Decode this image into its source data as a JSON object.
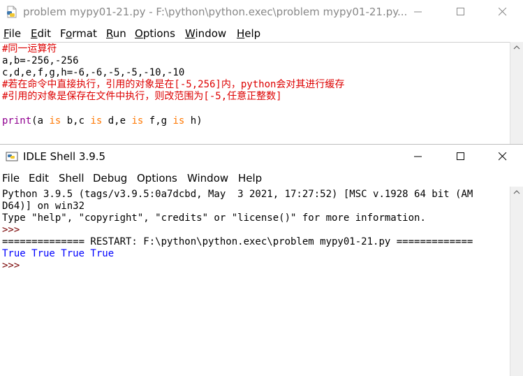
{
  "editor": {
    "title": "problem mypy01-21.py - F:\\python\\python.exec\\problem mypy01-21.py...",
    "menu": [
      {
        "pre": "",
        "u": "F",
        "post": "ile"
      },
      {
        "pre": "",
        "u": "E",
        "post": "dit"
      },
      {
        "pre": "F",
        "u": "o",
        "post": "rmat"
      },
      {
        "pre": "",
        "u": "R",
        "post": "un"
      },
      {
        "pre": "",
        "u": "O",
        "post": "ptions"
      },
      {
        "pre": "",
        "u": "W",
        "post": "indow"
      },
      {
        "pre": "",
        "u": "H",
        "post": "elp"
      }
    ],
    "lines": {
      "l1": "#同一运算符",
      "l2": "a,b=-256,-256",
      "l3": "c,d,e,f,g,h=-6,-6,-5,-5,-10,-10",
      "l4": "#若在命令中直接执行，引用的对象是在[-5,256]内，python会对其进行缓存",
      "l5": "#引用的对象是保存在文件中执行，则改范围为[-5,任意正整数]",
      "print": "print",
      "p_open": "(a ",
      "is": "is",
      "b_c": " b,c ",
      "d_e": " d,e ",
      "f_g": " f,g ",
      "h": " h)"
    },
    "icons": {
      "app": "python-file-icon"
    }
  },
  "shell": {
    "title": "IDLE Shell 3.9.5",
    "menu": [
      "File",
      "Edit",
      "Shell",
      "Debug",
      "Options",
      "Window",
      "Help"
    ],
    "lines": {
      "l1": "Python 3.9.5 (tags/v3.9.5:0a7dcbd, May  3 2021, 17:27:52) [MSC v.1928 64 bit (AM",
      "l2": "D64)] on win32",
      "l3": "Type \"help\", \"copyright\", \"credits\" or \"license()\" for more information.",
      "prompt": ">>>",
      "restart": "============== RESTART: F:\\python\\python.exec\\problem mypy01-21.py =============",
      "output": "True True True True"
    }
  },
  "window_controls": {
    "minimize": "—",
    "maximize": "☐",
    "close": "✕"
  }
}
